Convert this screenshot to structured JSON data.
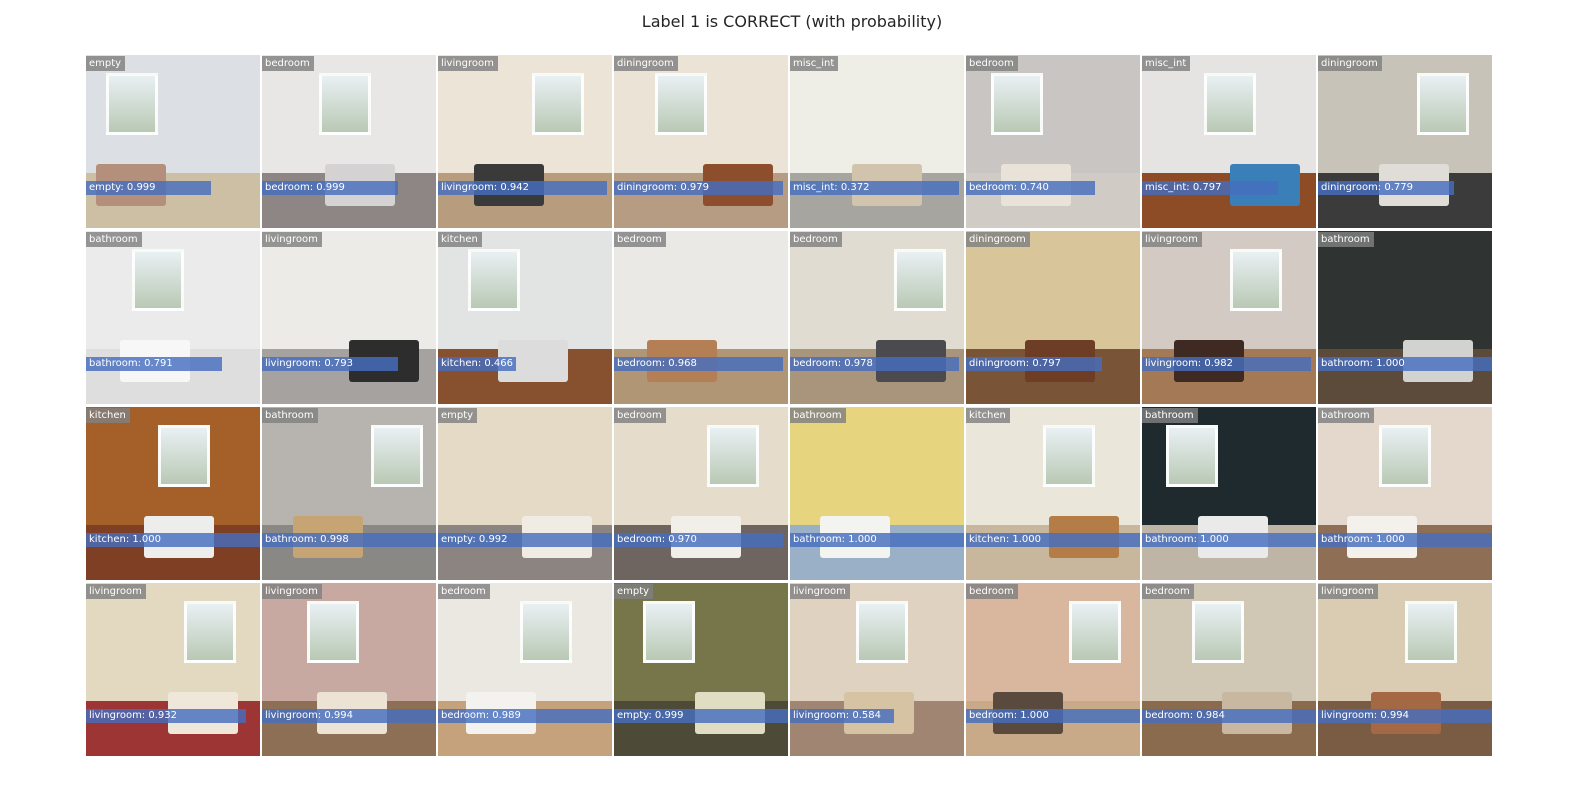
{
  "title": "Label 1 is CORRECT (with probability)",
  "tiles": [
    {
      "label": "empty",
      "prediction": "empty: 0.999",
      "wall": "#dcdfe3",
      "floor": "#cdbfa3",
      "win": true,
      "furn": "#b48f7c",
      "bar": 0.72
    },
    {
      "label": "bedroom",
      "prediction": "bedroom: 0.999",
      "wall": "#e9e6e6",
      "floor": "#8d8685",
      "win": true,
      "furn": "#d5d2d3",
      "bar": 0.78
    },
    {
      "label": "livingroom",
      "prediction": "livingroom: 0.942",
      "wall": "#ece4d6",
      "floor": "#b89c7e",
      "win": true,
      "furn": "#3a3a3a",
      "bar": 0.97
    },
    {
      "label": "diningroom",
      "prediction": "diningroom: 0.979",
      "wall": "#ebe3d5",
      "floor": "#b59c83",
      "win": true,
      "furn": "#8c4e2c",
      "bar": 0.97
    },
    {
      "label": "misc_int",
      "prediction": "misc_int: 0.372",
      "wall": "#eeede6",
      "floor": "#a7a5a0",
      "win": false,
      "furn": "#d2c4ac",
      "bar": 0.97
    },
    {
      "label": "bedroom",
      "prediction": "bedroom: 0.740",
      "wall": "#c9c5c3",
      "floor": "#d0cbc4",
      "win": true,
      "furn": "#e8e2d9",
      "bar": 0.74
    },
    {
      "label": "misc_int",
      "prediction": "misc_int: 0.797",
      "wall": "#e6e3e3",
      "floor": "#8d4b26",
      "win": true,
      "furn": "#3b7fb8",
      "bar": 0.78
    },
    {
      "label": "diningroom",
      "prediction": "diningroom: 0.779",
      "wall": "#c7c3b9",
      "floor": "#3b3b3b",
      "win": true,
      "furn": "#e0ddd8",
      "bar": 0.78
    },
    {
      "label": "bathroom",
      "prediction": "bathroom: 0.791",
      "wall": "#ebebeb",
      "floor": "#dedede",
      "win": true,
      "furn": "#f7f7f7",
      "bar": 0.78
    },
    {
      "label": "livingroom",
      "prediction": "livingroom: 0.793",
      "wall": "#ecebe8",
      "floor": "#a5a2a0",
      "win": false,
      "furn": "#2d2d2d",
      "bar": 0.78
    },
    {
      "label": "kitchen",
      "prediction": "kitchen: 0.466",
      "wall": "#e2e4e3",
      "floor": "#87512f",
      "win": true,
      "furn": "#dcdcdc",
      "bar": 0.45
    },
    {
      "label": "bedroom",
      "prediction": "bedroom: 0.968",
      "wall": "#ebe9e6",
      "floor": "#b09674",
      "win": false,
      "furn": "#b57f55",
      "bar": 0.97
    },
    {
      "label": "bedroom",
      "prediction": "bedroom: 0.978",
      "wall": "#e1dcd2",
      "floor": "#a9957c",
      "win": true,
      "furn": "#4a4a4f",
      "bar": 0.97
    },
    {
      "label": "diningroom",
      "prediction": "diningroom: 0.797",
      "wall": "#d8c599",
      "floor": "#7a5437",
      "win": false,
      "furn": "#6d3d26",
      "bar": 0.78
    },
    {
      "label": "livingroom",
      "prediction": "livingroom: 0.982",
      "wall": "#d3cac4",
      "floor": "#a37a55",
      "win": true,
      "furn": "#3e2a22",
      "bar": 0.97
    },
    {
      "label": "bathroom",
      "prediction": "bathroom: 1.000",
      "wall": "#2f3432",
      "floor": "#5c4a3a",
      "win": false,
      "furn": "#d2d3d0",
      "bar": 1.0
    },
    {
      "label": "kitchen",
      "prediction": "kitchen: 1.000",
      "wall": "#a5602a",
      "floor": "#7e3f24",
      "win": true,
      "furn": "#ededeb",
      "bar": 1.0
    },
    {
      "label": "bathroom",
      "prediction": "bathroom: 0.998",
      "wall": "#b7b4b0",
      "floor": "#8a8884",
      "win": true,
      "furn": "#c6a473",
      "bar": 1.0
    },
    {
      "label": "empty",
      "prediction": "empty: 0.992",
      "wall": "#e4dac5",
      "floor": "#8c8480",
      "win": false,
      "furn": "#f1ece3",
      "bar": 1.0
    },
    {
      "label": "bedroom",
      "prediction": "bedroom: 0.970",
      "wall": "#e6dccc",
      "floor": "#6e6560",
      "win": true,
      "furn": "#f2efe9",
      "bar": 0.97
    },
    {
      "label": "bathroom",
      "prediction": "bathroom: 1.000",
      "wall": "#e6d47e",
      "floor": "#9ab0c6",
      "win": false,
      "furn": "#f3f3ef",
      "bar": 1.0
    },
    {
      "label": "kitchen",
      "prediction": "kitchen: 1.000",
      "wall": "#ebe6da",
      "floor": "#c9b79d",
      "win": true,
      "furn": "#b47c46",
      "bar": 1.0
    },
    {
      "label": "bathroom",
      "prediction": "bathroom: 1.000",
      "wall": "#1e2a2d",
      "floor": "#bfb5a6",
      "win": true,
      "furn": "#eaeaea",
      "bar": 1.0
    },
    {
      "label": "bathroom",
      "prediction": "bathroom: 1.000",
      "wall": "#e4d7cb",
      "floor": "#8e6f55",
      "win": true,
      "furn": "#f4f1ec",
      "bar": 1.0
    },
    {
      "label": "livingroom",
      "prediction": "livingroom: 0.932",
      "wall": "#e2d9c0",
      "floor": "#9c3534",
      "win": true,
      "furn": "#efe7da",
      "bar": 0.92
    },
    {
      "label": "livingroom",
      "prediction": "livingroom: 0.994",
      "wall": "#c7a9a2",
      "floor": "#8d6f55",
      "win": true,
      "furn": "#ece3d4",
      "bar": 1.0
    },
    {
      "label": "bedroom",
      "prediction": "bedroom: 0.989",
      "wall": "#ebe7e1",
      "floor": "#c6a27c",
      "win": true,
      "furn": "#f3f2ef",
      "bar": 1.0
    },
    {
      "label": "empty",
      "prediction": "empty: 0.999",
      "wall": "#77754a",
      "floor": "#4d4b37",
      "win": true,
      "furn": "#e0ddc3",
      "bar": 1.0
    },
    {
      "label": "livingroom",
      "prediction": "livingroom: 0.584",
      "wall": "#e0d2c0",
      "floor": "#a08572",
      "win": true,
      "furn": "#d6c3a3",
      "bar": 0.6
    },
    {
      "label": "bedroom",
      "prediction": "bedroom: 1.000",
      "wall": "#d9b79f",
      "floor": "#c8a988",
      "win": true,
      "furn": "#5a4a3e",
      "bar": 1.0
    },
    {
      "label": "bedroom",
      "prediction": "bedroom: 0.984",
      "wall": "#d1c7b5",
      "floor": "#8a6b4d",
      "win": true,
      "furn": "#c8b7a1",
      "bar": 1.0
    },
    {
      "label": "livingroom",
      "prediction": "livingroom: 0.994",
      "wall": "#d9ccb3",
      "floor": "#7a5b44",
      "win": true,
      "furn": "#a56844",
      "bar": 1.0
    }
  ]
}
